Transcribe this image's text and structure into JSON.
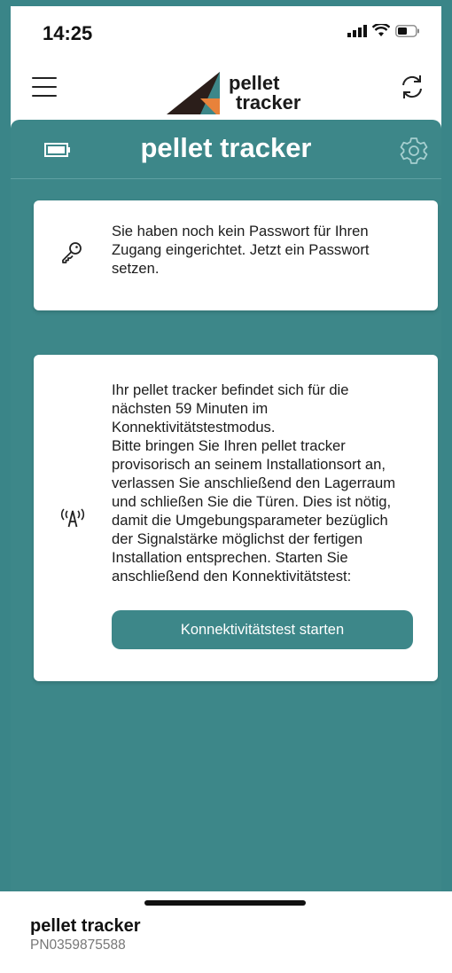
{
  "status_bar": {
    "time": "14:25"
  },
  "header": {
    "logo_line1": "pellet",
    "logo_line2": "tracker"
  },
  "panel": {
    "title": "pellet tracker"
  },
  "password_card": {
    "text": "Sie haben noch kein Passwort für Ihren Zugang eingerichtet. Jetzt ein Passwort setzen."
  },
  "connectivity_card": {
    "text": "Ihr pellet tracker befindet sich für die\nnächsten 59 Minuten im\nKonnektivitätstestmodus.\nBitte bringen Sie Ihren pellet tracker\nprovisorisch an seinem Installationsort an,\nverlassen Sie anschließend den Lagerraum\nund schließen Sie die Türen. Dies ist nötig,\ndamit die Umgebungsparameter bezüglich\nder Signalstärke möglichst der fertigen\nInstallation entsprechen. Starten Sie\nanschließend den Konnektivitätstest:",
    "button_label": "Konnektivitätstest starten"
  },
  "footer": {
    "device_name": "pellet tracker",
    "device_id": "PN0359875588"
  },
  "colors": {
    "accent": "#3d8789",
    "logo_dark": "#2b1e1a",
    "logo_orange": "#e8823a",
    "logo_teal": "#3d8789"
  },
  "icons": {
    "menu": "hamburger-icon",
    "refresh": "refresh-icon",
    "battery": "battery-icon",
    "settings": "gear-icon",
    "key": "key-icon",
    "antenna": "antenna-icon"
  }
}
